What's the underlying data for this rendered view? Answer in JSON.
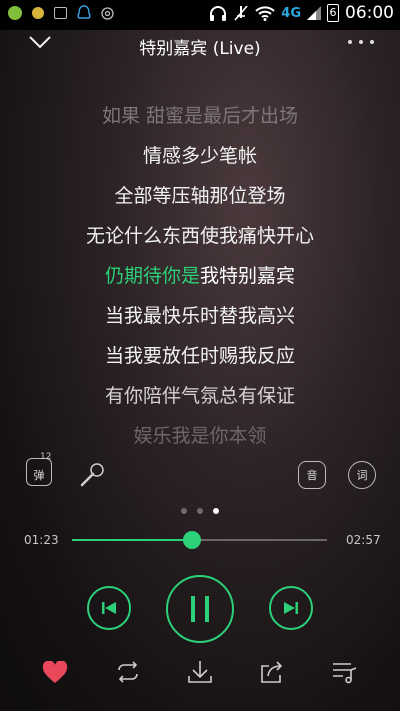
{
  "status_bar": {
    "network": "4G",
    "battery": "6",
    "time": "06:00"
  },
  "header": {
    "title": "特别嘉宾 (Live)"
  },
  "lyrics": {
    "lines": [
      "如果 甜蜜是最后才出场",
      "情感多少笔帐",
      "全部等压轴那位登场",
      "无论什么东西使我痛快开心",
      "",
      "当我最快乐时替我高兴",
      "当我要放任时赐我反应",
      "有你陪伴气氛总有保证",
      "娱乐我是你本领"
    ],
    "current": {
      "sung": "仍期待你是",
      "remaining": "我特别嘉宾"
    }
  },
  "tools": {
    "danmu_label": "弹",
    "danmu_count": "12",
    "sound_effect_label": "音",
    "lyrics_label": "词"
  },
  "pager": {
    "count": 3,
    "active": 2
  },
  "progress": {
    "elapsed": "01:23",
    "duration": "02:57",
    "fraction": 0.47
  },
  "colors": {
    "accent": "#2bd079",
    "like": "#e8485a"
  },
  "icons": {
    "back": "chevron-down-icon",
    "more": "more-dots-icon",
    "mic": "microphone-icon",
    "prev": "skip-previous-icon",
    "pause": "pause-icon",
    "next": "skip-next-icon",
    "like": "heart-icon",
    "loop": "repeat-icon",
    "download": "download-icon",
    "share": "share-icon",
    "playlist": "playlist-icon"
  }
}
